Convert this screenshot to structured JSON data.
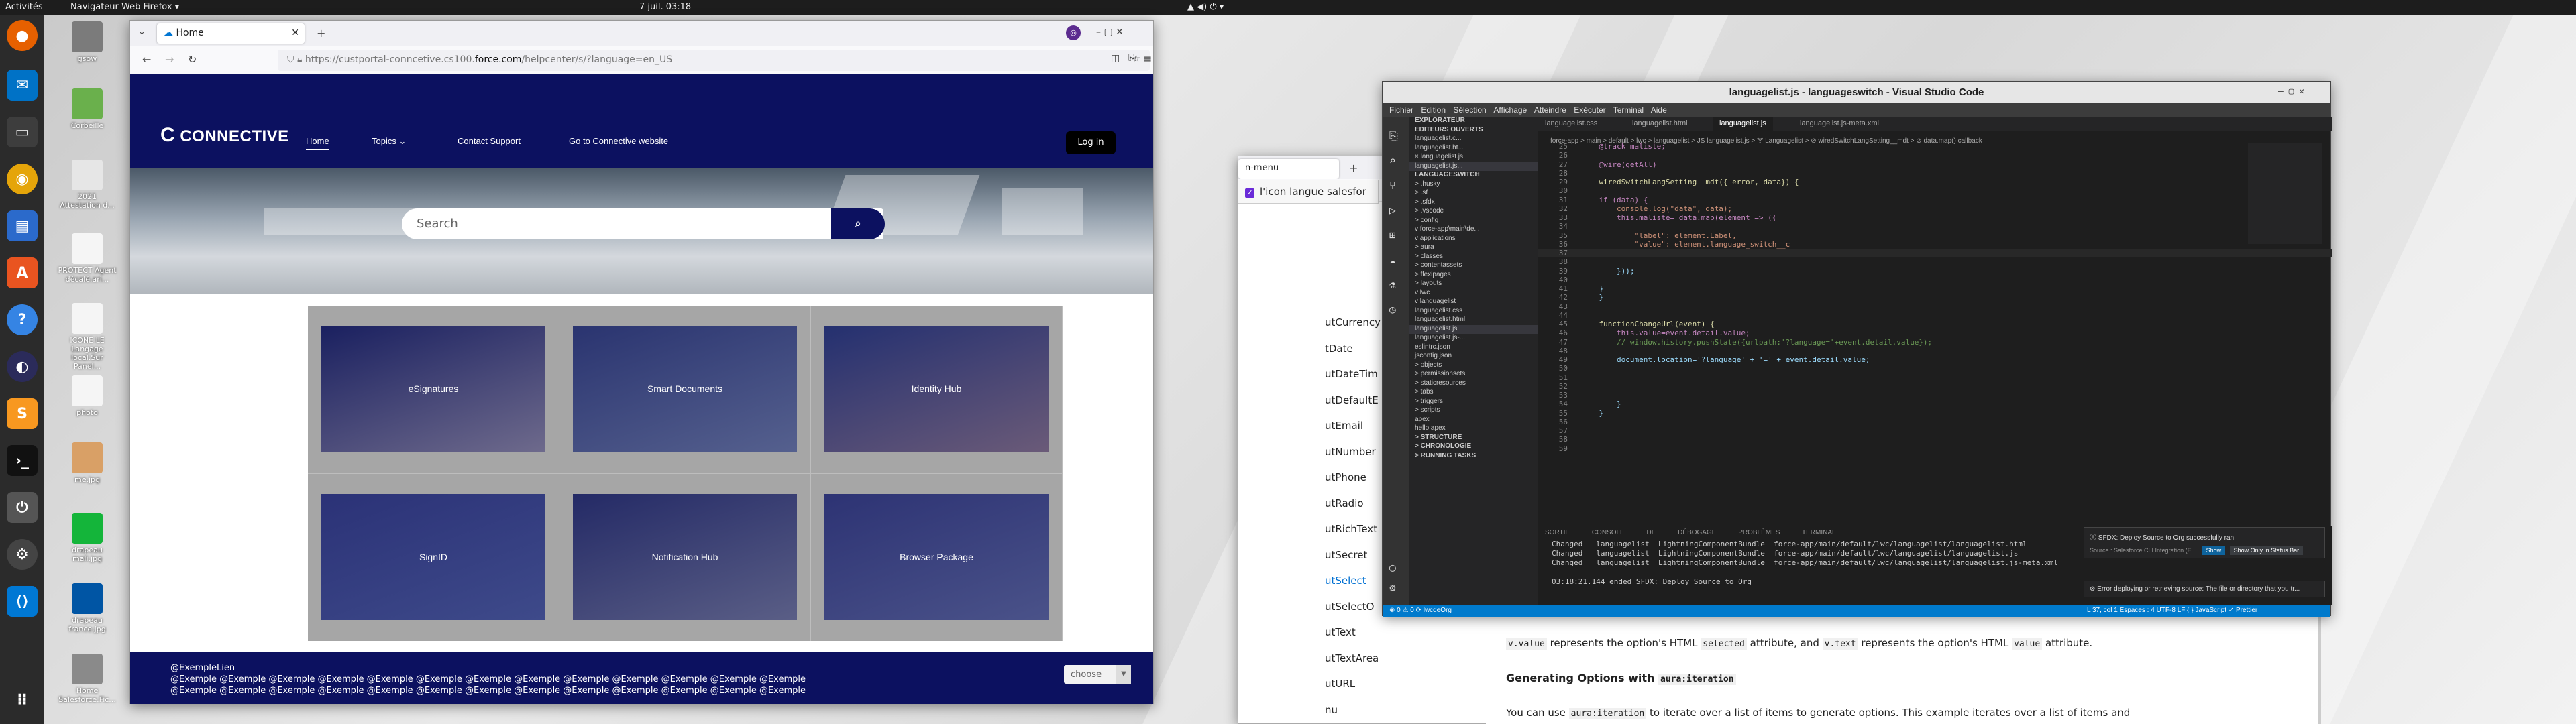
{
  "topbar": {
    "activities": "Activités",
    "app": "Navigateur Web Firefox ▾",
    "clock": "7 juil.  03:18",
    "tray": "▲  ◀)  ⏻ ▾"
  },
  "desktop": {
    "icons": [
      {
        "label": "gsow",
        "color": "#7b7b7b"
      },
      {
        "label": "Corbeille",
        "color": "#6ab04c"
      },
      {
        "label": "2021\nAttestation d...",
        "color": "#e6e6e6"
      },
      {
        "label": "PROTECT Agent\ndécalé.ari...",
        "color": "#f5f5f5"
      },
      {
        "label": "ICONE LE Langage\nlocal.Sur Panel...",
        "color": "#f5f5f5"
      },
      {
        "label": "photo",
        "color": "#f5f5f5"
      },
      {
        "label": "me.jpg",
        "color": "#d9a066"
      },
      {
        "label": "drapeau\nmali.jpg",
        "color": "#14b53a"
      },
      {
        "label": "drapeau\nfrance.jpg",
        "color": "#0055a4"
      },
      {
        "label": "Home\nSalesforce.Fic...",
        "color": "#8a8a8a"
      }
    ]
  },
  "firefox": {
    "tab_title": "Home",
    "url_prefix": "https://custportal-conncetive.cs100.",
    "url_domain": "force.com",
    "url_suffix": "/helpcenter/s/?language=en_US",
    "site": {
      "logo": "CONNECTIVE",
      "nav": [
        "Home",
        "Topics ⌄",
        "Contact Support",
        "Go to Connective website"
      ],
      "login": "Log in",
      "search_placeholder": "Search",
      "tiles": [
        "eSignatures",
        "Smart Documents",
        "Identity Hub",
        "SignID",
        "Notification Hub",
        "Browser Package"
      ],
      "footer_name": "@ExempleLien",
      "footer_line": "@Exemple @Exemple @Exemple @Exemple @Exemple @Exemple @Exemple @Exemple @Exemple @Exemple @Exemple @Exemple @Exemple",
      "choose": "choose"
    }
  },
  "firefox2": {
    "tab": "n-menu",
    "list": [
      "utCurrency",
      "tDate",
      "utDateTim",
      "utDefaultE",
      "utEmail",
      "utNumber",
      "utPhone",
      "utRadio",
      "utRichText",
      "utSecret",
      "utSelect",
      "utSelectO",
      "utText",
      "utTextArea",
      "utURL",
      "nu"
    ]
  },
  "dialog": {
    "text": "l'icon langue salesfor"
  },
  "doc": {
    "line1_a": "v.value",
    "line1_b": " represents the option's HTML ",
    "line1_c": "selected",
    "line1_d": " attribute, and ",
    "line1_e": "v.text",
    "line1_f": " represents the option's HTML ",
    "line1_g": "value",
    "line1_h": " attribute.",
    "heading_a": "Generating Options with ",
    "heading_b": "aura:iteration",
    "line2_a": "You can use ",
    "line2_b": "aura:iteration",
    "line2_c": " to iterate over a list of items to generate options. This example iterates over a list of items and"
  },
  "vscode": {
    "title": "languagelist.js - languageswitch - Visual Studio Code",
    "menu": "Fichier Edition Sélection Affichage Atteindre Exécuter Terminal Aide",
    "sidebar": [
      "EXPLORATEUR",
      "EDITEURS OUVERTS",
      "  languagelist.c...",
      "  languagelist.ht...",
      "  × languagelist.js",
      "  languagelist.js...",
      "LANGUAGESWITCH",
      "> .husky",
      "> .sf",
      "> .sfdx",
      "> .vscode",
      "> config",
      "v force-app\\main\\de...",
      "  v applications",
      "    > aura",
      "    > classes",
      "    > contentassets",
      "    > flexipages",
      "    > layouts",
      "    v lwc",
      "      v languagelist",
      "        languagelist.css",
      "        languagelist.html",
      "        languagelist.js",
      "        languagelist.js-...",
      "      eslintrc.json",
      "      jsconfig.json",
      "    > objects",
      "    > permissionsets",
      "    > staticresources",
      "    > tabs",
      "    > triggers",
      "> scripts",
      "  apex",
      "  hello.apex",
      "> STRUCTURE",
      "> CHRONOLOGIE",
      "> RUNNING TASKS"
    ],
    "tabs": [
      "languagelist.css",
      "languagelist.html",
      "languagelist.js",
      "languagelist.js-meta.xml"
    ],
    "crumbs": "force-app > main > default > lwc > languagelist > JS languagelist.js > 🝖 Languagelist > ⊘ wiredSwitchLangSetting__mdt > ⊘ data.map() callback",
    "code": [
      {
        "n": "25",
        "t": "    @track maliste;"
      },
      {
        "n": "26",
        "t": ""
      },
      {
        "n": "27",
        "t": "    @wire(getAll)"
      },
      {
        "n": "28",
        "t": ""
      },
      {
        "n": "29",
        "t": "    wiredSwitchLangSetting__mdt({ error, data}) {"
      },
      {
        "n": "30",
        "t": ""
      },
      {
        "n": "31",
        "t": "    if (data) {"
      },
      {
        "n": "32",
        "t": "        console.log(\"data\", data);"
      },
      {
        "n": "33",
        "t": "        this.maliste= data.map(element => ({"
      },
      {
        "n": "34",
        "t": ""
      },
      {
        "n": "35",
        "t": "            \"label\": element.Label,"
      },
      {
        "n": "36",
        "t": "            \"value\": element.language_switch__c"
      },
      {
        "n": "37",
        "t": ""
      },
      {
        "n": "38",
        "t": ""
      },
      {
        "n": "39",
        "t": "        }));"
      },
      {
        "n": "40",
        "t": ""
      },
      {
        "n": "41",
        "t": "    }"
      },
      {
        "n": "42",
        "t": "    }"
      },
      {
        "n": "43",
        "t": ""
      },
      {
        "n": "44",
        "t": ""
      },
      {
        "n": "45",
        "t": "    functionChangeUrl(event) {"
      },
      {
        "n": "46",
        "t": "        this.value=event.detail.value;"
      },
      {
        "n": "47",
        "t": "        // window.history.pushState({urlpath:'?language='+event.detail.value});"
      },
      {
        "n": "48",
        "t": ""
      },
      {
        "n": "49",
        "t": "        document.location='?language' + '=' + event.detail.value;"
      },
      {
        "n": "50",
        "t": ""
      },
      {
        "n": "51",
        "t": ""
      },
      {
        "n": "52",
        "t": ""
      },
      {
        "n": "53",
        "t": ""
      },
      {
        "n": "54",
        "t": "        }"
      },
      {
        "n": "55",
        "t": "    }"
      },
      {
        "n": "56",
        "t": ""
      },
      {
        "n": "57",
        "t": ""
      },
      {
        "n": "58",
        "t": ""
      },
      {
        "n": "59",
        "t": ""
      }
    ],
    "panel_tabs": "SORTIE CONSOLE DE DÉBOGAGE PROBLÈMES TERMINAL",
    "panel_lines": [
      "Changed   languagelist  LightningComponentBundle  force-app/main/default/lwc/languagelist/languagelist.html",
      "Changed   languagelist  LightningComponentBundle  force-app/main/default/lwc/languagelist/languagelist.js",
      "Changed   languagelist  LightningComponentBundle  force-app/main/default/lwc/languagelist/languagelist.js-meta.xml",
      "",
      "03:18:21.144 ended SFDX: Deploy Source to Org"
    ],
    "notif1": "ⓘ SFDX: Deploy Source to Org successfully ran",
    "notif1_sub": "Source : Salesforce CLI Integration (E...",
    "notif1_btn1": "Show",
    "notif1_btn2": "Show Only in Status Bar",
    "notif2": "⊗ Error deploying or retrieving source: The file or directory that you tr...",
    "status_left": "⊗ 0 ⚠ 0   ⟳ lwcdeOrg",
    "status_right": "L 37, col 1   Espaces : 4   UTF-8   LF   { } JavaScript   ✓ Prettier"
  }
}
